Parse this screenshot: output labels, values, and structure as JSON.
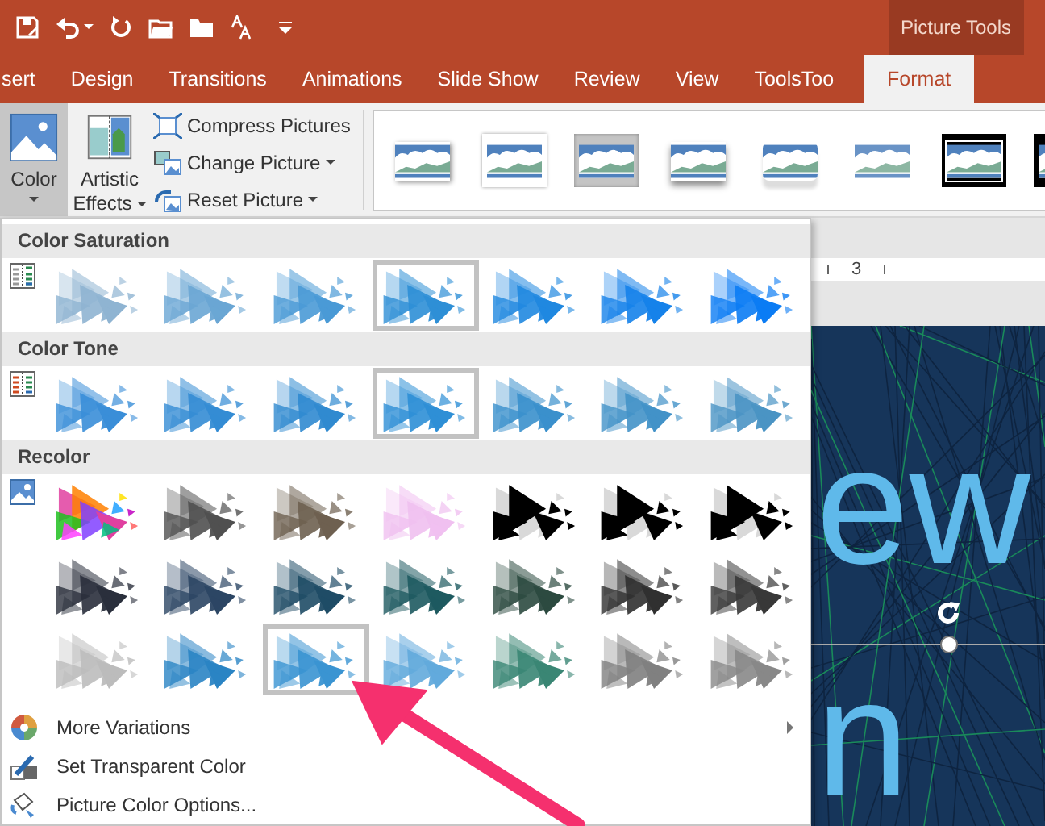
{
  "contextual_tab_group": "Picture Tools",
  "tabs": [
    {
      "label": "sert",
      "selected": false
    },
    {
      "label": "Design",
      "selected": false
    },
    {
      "label": "Transitions",
      "selected": false
    },
    {
      "label": "Animations",
      "selected": false
    },
    {
      "label": "Slide Show",
      "selected": false
    },
    {
      "label": "Review",
      "selected": false
    },
    {
      "label": "View",
      "selected": false
    },
    {
      "label": "ToolsToo",
      "selected": false
    },
    {
      "label": "Format",
      "selected": true
    }
  ],
  "ribbon": {
    "color_button": {
      "label": "Color",
      "pressed": true
    },
    "artistic_effects": {
      "label_lines": [
        "Artistic",
        "Effects"
      ]
    },
    "adjust_commands": [
      {
        "kind": "compress",
        "label": "Compress Pictures",
        "dropdown": false
      },
      {
        "kind": "change",
        "label": "Change Picture",
        "dropdown": true
      },
      {
        "kind": "reset",
        "label": "Reset Picture",
        "dropdown": true
      }
    ],
    "picture_styles": [
      {
        "kind": "shadow"
      },
      {
        "kind": "white-frame"
      },
      {
        "kind": "matte"
      },
      {
        "kind": "soft-shadow"
      },
      {
        "kind": "reflected"
      },
      {
        "kind": "soft-edges"
      },
      {
        "kind": "double-frame"
      },
      {
        "kind": "black-frame"
      }
    ]
  },
  "color_menu": {
    "sections": [
      {
        "title": "Color Saturation",
        "kind": "saturation",
        "rows": [
          [
            {
              "kind": "tint",
              "color": "#8fb4d2",
              "selected": false
            },
            {
              "kind": "tint",
              "color": "#6aa6d4",
              "selected": false
            },
            {
              "kind": "tint",
              "color": "#4a9ad6",
              "selected": false
            },
            {
              "kind": "tint",
              "color": "#2e8fd6",
              "selected": true
            },
            {
              "kind": "tint",
              "color": "#2088e0",
              "selected": false
            },
            {
              "kind": "tint",
              "color": "#1582ea",
              "selected": false
            },
            {
              "kind": "tint",
              "color": "#0b7cf4",
              "selected": false
            }
          ]
        ]
      },
      {
        "title": "Color Tone",
        "kind": "tone",
        "rows": [
          [
            {
              "kind": "tint",
              "color": "#3a8ed8",
              "selected": false
            },
            {
              "kind": "tint",
              "color": "#348cd4",
              "selected": false
            },
            {
              "kind": "tint",
              "color": "#308ad0",
              "selected": false
            },
            {
              "kind": "tint",
              "color": "#2e8fd6",
              "selected": true
            },
            {
              "kind": "tint",
              "color": "#3a90cc",
              "selected": false
            },
            {
              "kind": "tint",
              "color": "#4292c8",
              "selected": false
            },
            {
              "kind": "tint",
              "color": "#4a94c4",
              "selected": false
            }
          ]
        ]
      },
      {
        "title": "Recolor",
        "kind": "recolor",
        "rows": [
          [
            {
              "kind": "multicolor",
              "color": "#e040a0",
              "selected": false
            },
            {
              "kind": "tint",
              "color": "#505050",
              "selected": false
            },
            {
              "kind": "tint",
              "color": "#6e6050",
              "selected": false
            },
            {
              "kind": "tint",
              "color": "#f0c0f0",
              "selected": false
            },
            {
              "kind": "threshold",
              "color": "#000000",
              "selected": false
            },
            {
              "kind": "threshold",
              "color": "#000000",
              "selected": false
            },
            {
              "kind": "threshold",
              "color": "#000000",
              "selected": false
            }
          ],
          [
            {
              "kind": "tint",
              "color": "#2a2f3c",
              "selected": false
            },
            {
              "kind": "tint",
              "color": "#2c4664",
              "selected": false
            },
            {
              "kind": "tint",
              "color": "#1f4c66",
              "selected": false
            },
            {
              "kind": "tint",
              "color": "#1e5a60",
              "selected": false
            },
            {
              "kind": "tint",
              "color": "#2c4a40",
              "selected": false
            },
            {
              "kind": "tint",
              "color": "#303030",
              "selected": false
            },
            {
              "kind": "tint",
              "color": "#383838",
              "selected": false
            }
          ],
          [
            {
              "kind": "tint",
              "color": "#bcbcbc",
              "selected": false
            },
            {
              "kind": "tint",
              "color": "#2a84c4",
              "selected": false
            },
            {
              "kind": "tint",
              "color": "#3a94d2",
              "selected": true
            },
            {
              "kind": "tint",
              "color": "#62aadc",
              "selected": false
            },
            {
              "kind": "tint",
              "color": "#3a8674",
              "selected": false
            },
            {
              "kind": "tint",
              "color": "#808080",
              "selected": false
            },
            {
              "kind": "tint",
              "color": "#888888",
              "selected": false
            }
          ]
        ]
      }
    ],
    "commands": [
      {
        "kind": "variations",
        "label": "More Variations",
        "submenu": true
      },
      {
        "kind": "transparent",
        "label": "Set Transparent Color",
        "submenu": false
      },
      {
        "kind": "options",
        "label": "Picture Color Options...",
        "submenu": false
      }
    ]
  },
  "slide": {
    "ruler_label": "3",
    "text_lines": [
      "ew",
      "n"
    ]
  }
}
